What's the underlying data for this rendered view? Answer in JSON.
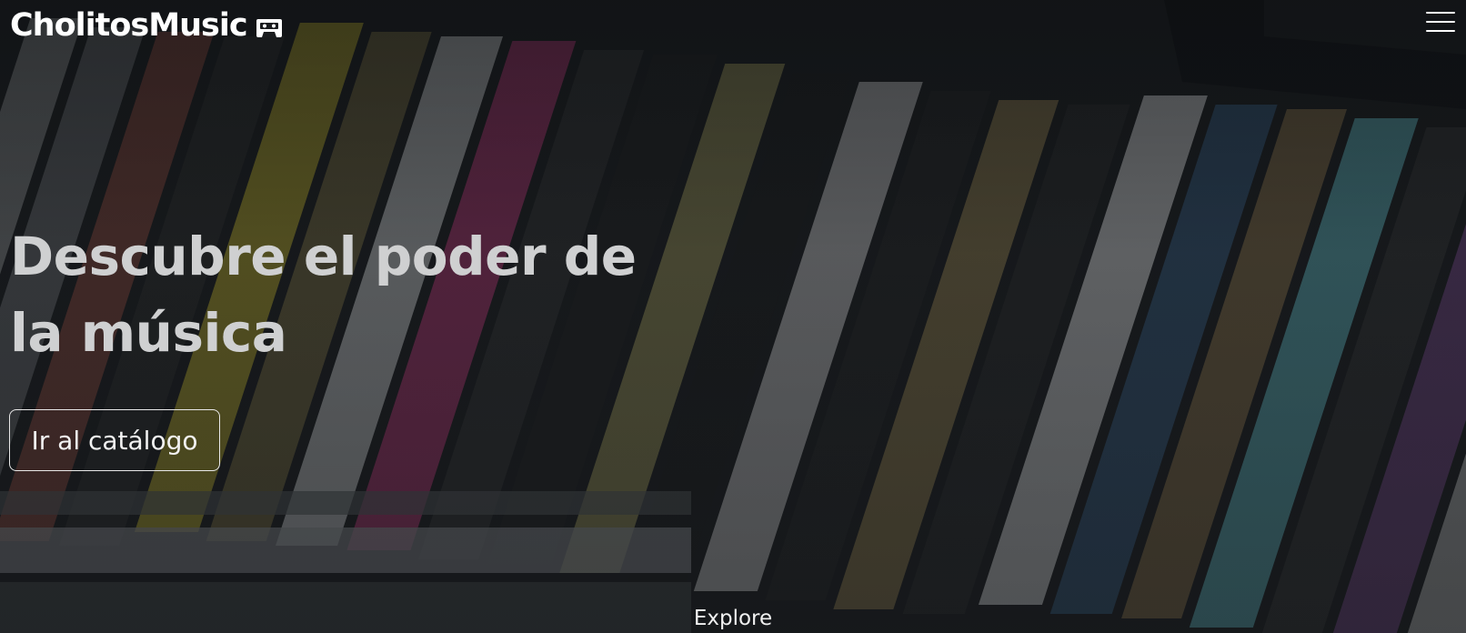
{
  "navbar": {
    "brand_name": "CholitosMusic",
    "brand_icon": "cassette-icon",
    "menu_icon": "hamburger-menu-icon"
  },
  "hero": {
    "background_image": "cd-case-spines-photo",
    "headline": "Descubre el poder de la música",
    "cta_label": "Ir al catálogo",
    "explore_label": "Explore"
  },
  "colors": {
    "text_primary": "#ffffff",
    "headline_text": "#cfd0d1",
    "background_dark": "#15181b"
  }
}
